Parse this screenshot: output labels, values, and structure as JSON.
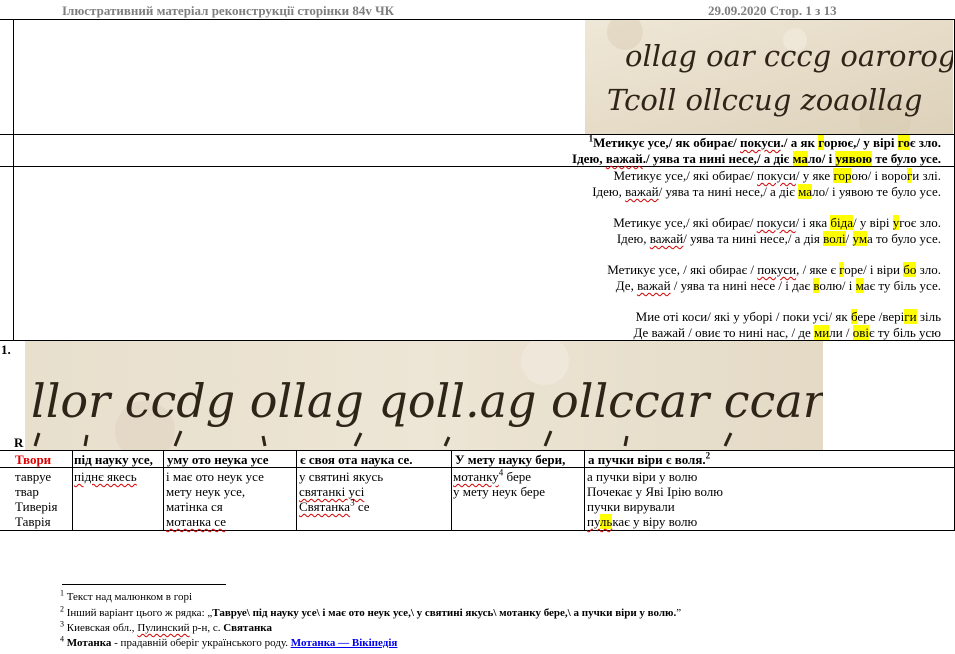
{
  "header": {
    "title": "Ілюстративний матеріал  реконструкції сторінки 84v ЧК",
    "date_page": "29.09.2020  Стор. 1 з 13"
  },
  "row_caption": {
    "line1": {
      "sup": "1",
      "a": "Метикує усе,/ як обирає/ ",
      "b": "покуси",
      "c": "./ а як  ",
      "d": "г",
      "e": "орює,/ у вірі ",
      "f": "го",
      "g": "є зло."
    },
    "line2": {
      "a": "Ідею, ",
      "b": "важай",
      "c": "./ уява та нині несе,/ а діє ",
      "d": "ма",
      "e": "ло/ і ",
      "f": "уявою",
      "g": " те було усе."
    }
  },
  "variants": [
    {
      "l1": {
        "a": "Метикує усе,/ які обирає/ ",
        "b": "покуси",
        "c": "/ у яке ",
        "d": "гор",
        "e": "ою/ і воро",
        "f": "г",
        "g": "и злі."
      },
      "l2": {
        "a": "Ідею, ",
        "b": "важай",
        "c": "/ уява та нині несе,/ а діє ",
        "d": "ма",
        "e": "ло/ і уявою те було усе."
      }
    },
    {
      "l1": {
        "a": "Метикує усе,/ які обирає/ ",
        "b": "покуси",
        "c": "/ і яка  ",
        "d": "біда",
        "e": "/ у вірі ",
        "f": "у",
        "g": "гоє зло."
      },
      "l2": {
        "a": "Ідею, ",
        "b": "важай",
        "c": "/ уява та нині несе,/ а дія ",
        "d": "волі",
        "e": "/ ",
        "f": "ум",
        "g": "а то було усе."
      }
    },
    {
      "l1": {
        "a": "Метикує усе, / які обирає / ",
        "b": "покуси",
        "c": ", / яке є  ",
        "d": "г",
        "e": "оре/ і віри ",
        "f": "бо",
        "g": " зло."
      },
      "l2": {
        "a": "Де, ",
        "b": "важай",
        "c": " / уява та нині несе / і дає ",
        "d": "в",
        "e": "олю/ і ",
        "f": "м",
        "g": "ає ту біль усе."
      }
    },
    {
      "l1": {
        "a": "Мие оті коси/ які у уборі / поки усі/ як ",
        "b": "б",
        "c": "ере /вері",
        "d": "ги",
        "e": " зіль"
      },
      "l2": {
        "a": "Де важай / овиє то нині нас, / де ",
        "b": "ми",
        "c": "ли / ",
        "d": "ові",
        "e": "є ту біль усю"
      }
    }
  ],
  "row_labels": {
    "one": "1.",
    "r": "R"
  },
  "table": {
    "headers": [
      {
        "text": "Твори",
        "red": true
      },
      {
        "text": "під науку усе,",
        "red": false
      },
      {
        "text": "уму ото неука усе",
        "red": false
      },
      {
        "text": "є своя ота наука се.",
        "red": false
      },
      {
        "text": "У мету науку бери,",
        "red": false
      },
      {
        "text": "а пучки віри є воля.",
        "sup": "2",
        "red": false
      }
    ],
    "col1": [
      "тавруе",
      "твар",
      "Тиверія",
      "Таврія"
    ],
    "col2": [
      "піднє якесь"
    ],
    "col3": [
      "і має ото неук усе",
      "мету неук усе,",
      "матінка ся",
      "мотанка се"
    ],
    "col4": [
      "у святині якусь",
      "святанкі усі",
      "Святанка",
      "3",
      " се"
    ],
    "col5": [
      "мотанку",
      "4",
      " бере",
      "у мету неук бере"
    ],
    "col6": [
      "а пучки віри у волю",
      "Почекає у Яві Ірію волю",
      "пучки вирували",
      "пу",
      "ль",
      "кає у віру волю"
    ]
  },
  "footnotes": {
    "f1": {
      "n": "1",
      "text": " Текст над малюнком в горі"
    },
    "f2": {
      "n": "2",
      "a": " Інший варіант цього ж рядка: „",
      "b": "Тавруе\\ під науку усе\\ і має ото неук усе,\\ у святині якусь\\ мотанку бере,\\ а пучки віри у волю.",
      "c": "”"
    },
    "f3": {
      "n": "3",
      "a": " Киевская обл., ",
      "b": "Пулинский",
      "c": " р-н, с. ",
      "d": "Святанка"
    },
    "f4": {
      "n": "4",
      "a": "Мотанка",
      "b": " - прадавній оберіг українського роду. ",
      "c": "Мотанка — Вікіпедія"
    }
  },
  "manuscript": {
    "top_line1": "ollag oar cccg oarorog",
    "top_line2": "Tcoll ollccug zoaollag",
    "bottom_line1": "llor ccdg ollag qoll.ag ollccar ccarorog",
    "colors": {
      "parchment": "#e9e0cf",
      "ink": "#2e2418"
    }
  }
}
